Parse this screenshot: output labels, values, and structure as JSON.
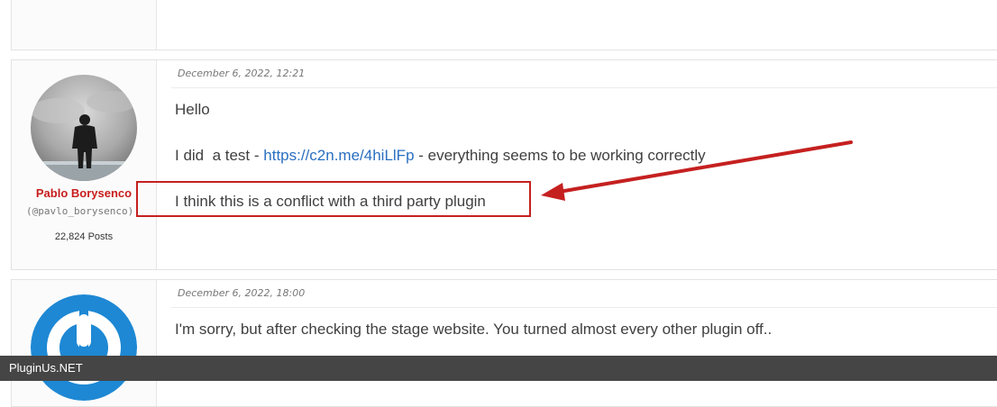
{
  "posts": [
    {
      "date": "",
      "author": null,
      "lines": []
    },
    {
      "date": "December 6, 2022, 12:21",
      "author": {
        "name": "Pablo Borysenco",
        "handle": "(@pavlo_borysenco)",
        "posts": "22,824 Posts",
        "avatar_icon": "person-silhouette-avatar"
      },
      "lines": {
        "hello": "Hello",
        "test_before": "I did  a test - ",
        "test_link": "https://c2n.me/4hiLlFp",
        "test_after": " - everything seems to be working correctly",
        "conflict": "I think this is a conflict with a third party plugin"
      }
    },
    {
      "date": "December 6, 2022, 18:00",
      "author": {
        "avatar_icon": "power-logo-avatar"
      },
      "lines": {
        "sorry": "I'm sorry, but after checking the stage website. You turned almost every other plugin off.."
      }
    }
  ],
  "annotation": {
    "color": "#c52020",
    "arrow_icon": "red-arrow-icon"
  },
  "footer": {
    "site": "PluginUs.NET"
  }
}
